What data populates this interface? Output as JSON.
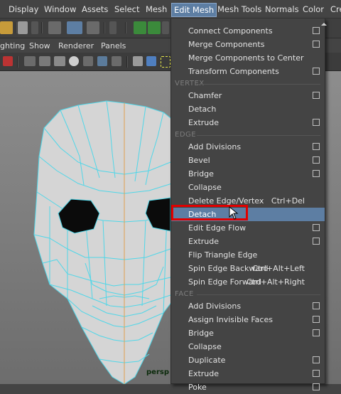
{
  "menubar": [
    "Display",
    "Window",
    "Assets",
    "Select",
    "Mesh",
    "Edit Mesh",
    "Mesh Tools",
    "Normals",
    "Color",
    "Cre"
  ],
  "panel_menu": [
    "ghting",
    "Show",
    "Renderer",
    "Panels"
  ],
  "viewport": {
    "camera": "persp"
  },
  "dropdown": {
    "items": [
      {
        "label": "Connect Components",
        "option": true
      },
      {
        "label": "Merge Components",
        "option": true
      },
      {
        "label": "Merge Components to Center",
        "option": false
      },
      {
        "label": "Transform Components",
        "option": true
      },
      {
        "section": "VERTEX"
      },
      {
        "label": "Chamfer",
        "option": true
      },
      {
        "label": "Detach",
        "option": false
      },
      {
        "label": "Extrude",
        "option": true
      },
      {
        "section": "EDGE"
      },
      {
        "label": "Add Divisions",
        "option": true
      },
      {
        "label": "Bevel",
        "option": true
      },
      {
        "label": "Bridge",
        "option": true
      },
      {
        "label": "Collapse",
        "option": false
      },
      {
        "label": "Delete Edge/Vertex",
        "shortcut": "Ctrl+Del",
        "option": false
      },
      {
        "label": "Detach",
        "option": false,
        "highlighted": true
      },
      {
        "label": "Edit Edge Flow",
        "option": true
      },
      {
        "label": "Extrude",
        "option": true
      },
      {
        "label": "Flip Triangle Edge",
        "option": false
      },
      {
        "label": "Spin Edge Backward",
        "shortcut": "Ctrl+Alt+Left",
        "option": false
      },
      {
        "label": "Spin Edge Forward",
        "shortcut": "Ctrl+Alt+Right",
        "option": false
      },
      {
        "section": "FACE"
      },
      {
        "label": "Add Divisions",
        "option": true
      },
      {
        "label": "Assign Invisible Faces",
        "option": true
      },
      {
        "label": "Bridge",
        "option": true
      },
      {
        "label": "Collapse",
        "option": false
      },
      {
        "label": "Duplicate",
        "option": true
      },
      {
        "label": "Extrude",
        "option": true
      },
      {
        "label": "Poke",
        "option": true
      }
    ]
  },
  "colors": {
    "highlight": "#5d7ea3",
    "callout": "#e00000",
    "wireframe": "#4fd6e8",
    "menu_bg": "#444444"
  }
}
